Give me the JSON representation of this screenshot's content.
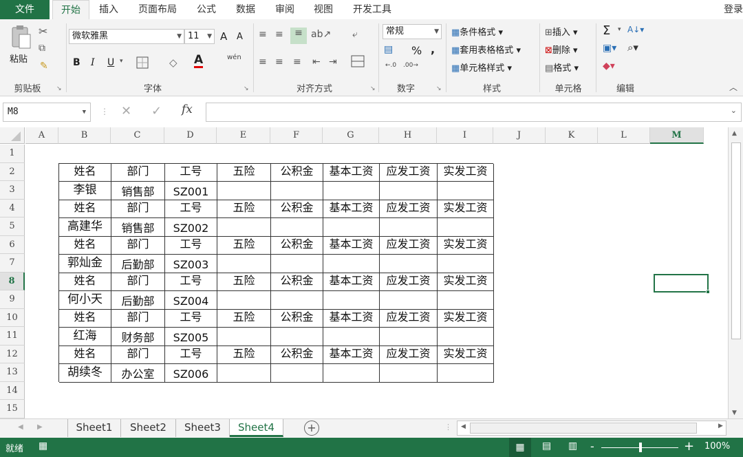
{
  "menu": {
    "file": "文件",
    "tabs": [
      "开始",
      "插入",
      "页面布局",
      "公式",
      "数据",
      "审阅",
      "视图",
      "开发工具"
    ],
    "active_tab": "开始",
    "login": "登录"
  },
  "ribbon": {
    "clipboard": {
      "paste": "粘贴",
      "label": "剪贴板"
    },
    "font": {
      "name": "微软雅黑",
      "size": "11",
      "bold": "B",
      "italic": "I",
      "underline": "U",
      "label": "字体",
      "grow": "A",
      "shrink": "A",
      "font_color_glyph": "A",
      "phonetic": "wén"
    },
    "alignment": {
      "label": "对齐方式"
    },
    "number": {
      "format": "常规",
      "percent": "%",
      "comma": ",",
      "label": "数字"
    },
    "styles": {
      "conditional": "条件格式",
      "table": "套用表格格式",
      "cell_styles": "单元格样式",
      "label": "样式"
    },
    "cells": {
      "insert": "插入",
      "delete": "删除",
      "format": "格式",
      "label": "单元格"
    },
    "editing": {
      "sum": "Σ",
      "label": "编辑"
    }
  },
  "formula_bar": {
    "name_box": "M8",
    "fx": "fx",
    "content": ""
  },
  "columns": [
    "A",
    "B",
    "C",
    "D",
    "E",
    "F",
    "G",
    "H",
    "I",
    "J",
    "K",
    "L",
    "M"
  ],
  "selected_column": "M",
  "rows": [
    "1",
    "2",
    "3",
    "4",
    "5",
    "6",
    "7",
    "8",
    "9",
    "10",
    "11",
    "12",
    "13",
    "14",
    "15"
  ],
  "selected_row": "8",
  "table": {
    "header": [
      "姓名",
      "部门",
      "工号",
      "五险",
      "公积金",
      "基本工资",
      "应发工资",
      "实发工资"
    ],
    "records": [
      [
        "李银",
        "销售部",
        "SZ001"
      ],
      [
        "高建华",
        "销售部",
        "SZ002"
      ],
      [
        "郭灿金",
        "后勤部",
        "SZ003"
      ],
      [
        "何小天",
        "后勤部",
        "SZ004"
      ],
      [
        "红海",
        "财务部",
        "SZ005"
      ],
      [
        "胡续冬",
        "办公室",
        "SZ006"
      ]
    ]
  },
  "sheets": [
    "Sheet1",
    "Sheet2",
    "Sheet3",
    "Sheet4"
  ],
  "active_sheet": "Sheet4",
  "status": {
    "ready": "就绪",
    "zoom": "100%",
    "minus": "-",
    "plus": "+"
  },
  "colors": {
    "excel_green": "#217346"
  }
}
